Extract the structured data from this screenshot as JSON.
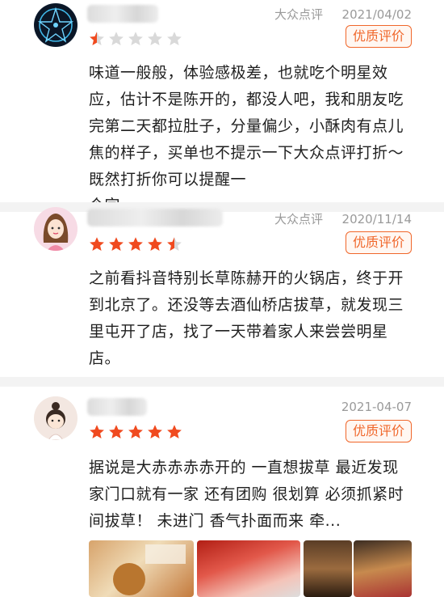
{
  "reviews": [
    {
      "source": "大众点评",
      "date": "2021/04/02",
      "badge": "优质评价",
      "rating": 0.5,
      "text": "味道一般般，体验感极差，也就吃个明星效应，估计不是陈开的，都没人吧，我和朋友吃完第二天都拉肚子，分量偏少，小酥肉有点儿焦的样子，买单也不提示一下大众点评打折～既然打折你可以提醒一",
      "text_cut": "个字"
    },
    {
      "source": "大众点评",
      "date": "2020/11/14",
      "badge": "优质评价",
      "rating": 4.5,
      "text": "之前看抖音特别长草陈赫开的火锅店，终于开到北京了。还没等去酒仙桥店拔草，就发现三里屯开了店，找了一天带着家人来尝尝明星店。"
    },
    {
      "source": "",
      "date": "2021-04-07",
      "badge": "优质评价",
      "rating": 5,
      "text": "据说是大赤赤赤赤开的 一直想拔草 最近发现家门口就有一家 还有团购 很划算 必须抓紧时间拔草！ 未进门 香气扑面而来 牵..."
    }
  ],
  "colors": {
    "star_filled": "#f04a1f",
    "star_empty": "#d9d9d9",
    "badge": "#f0672b"
  },
  "icons": [
    "pentagram-avatar-icon",
    "cartoon-girl-avatar",
    "cartoon-baby-avatar",
    "star-icon"
  ],
  "photos": [
    "food-photo-1",
    "food-photo-2",
    "food-photo-3",
    "food-photo-4"
  ]
}
